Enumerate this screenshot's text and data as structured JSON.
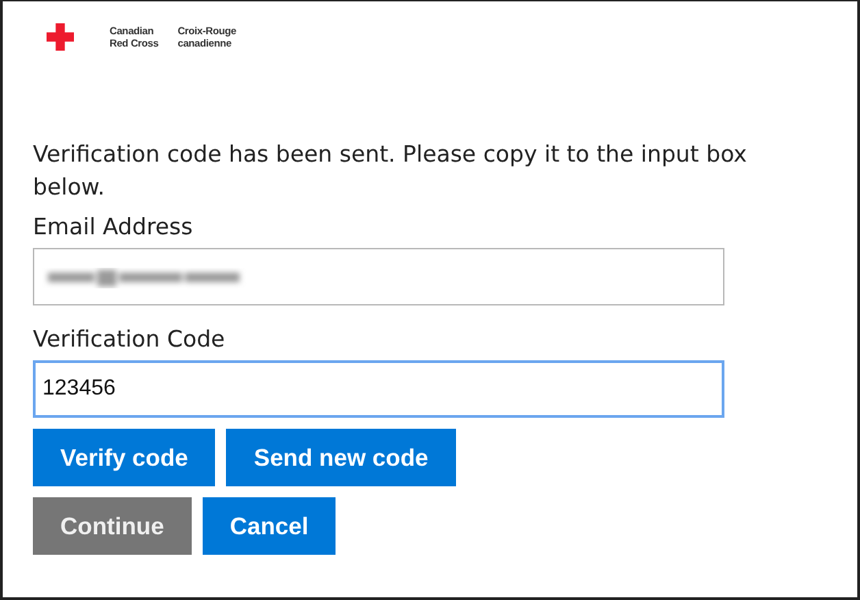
{
  "logo": {
    "english_lines": [
      "Canadian",
      "Red Cross"
    ],
    "french_lines": [
      "Croix-Rouge",
      "canadienne"
    ]
  },
  "message": "Verification code has been sent. Please copy it to the input box below.",
  "fields": [
    {
      "label": "Email Address",
      "value_blurred": true,
      "focused": false
    },
    {
      "label": "Verification Code",
      "value": "123456",
      "focused": true
    }
  ],
  "button_rows": [
    [
      {
        "label": "Verify code",
        "disabled": false
      },
      {
        "label": "Send new code",
        "disabled": false
      }
    ],
    [
      {
        "label": "Continue",
        "disabled": true
      },
      {
        "label": "Cancel",
        "disabled": false
      }
    ]
  ]
}
